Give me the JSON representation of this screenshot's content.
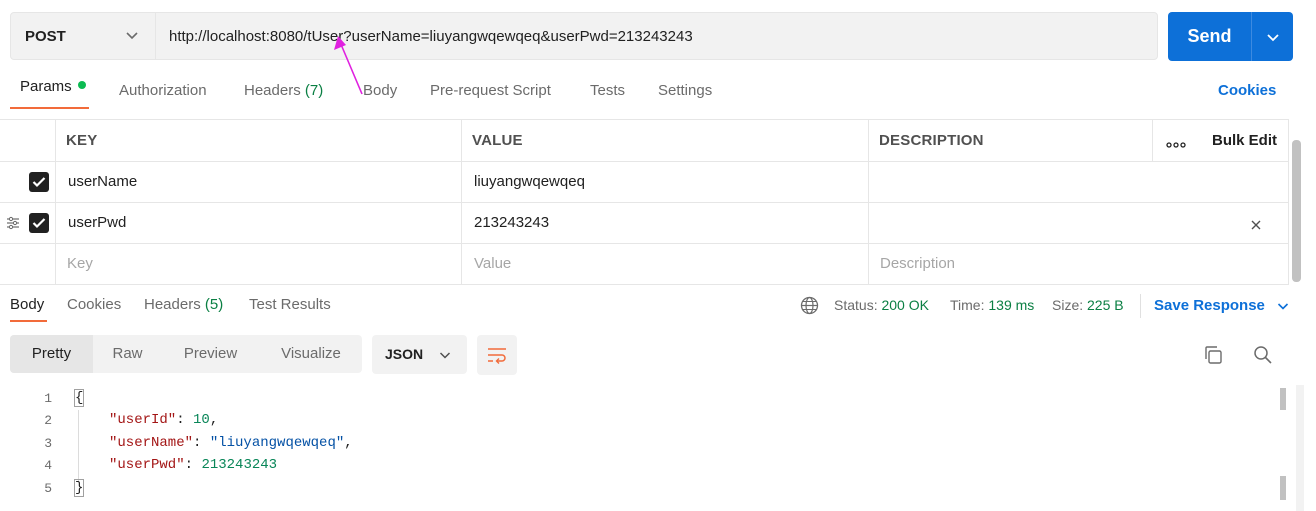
{
  "request": {
    "method": "POST",
    "url": "http://localhost:8080/tUser?userName=liuyangwqewqeq&userPwd=213243243",
    "send_label": "Send"
  },
  "request_tabs": {
    "params": "Params",
    "authorization": "Authorization",
    "headers": "Headers",
    "headers_count": "(7)",
    "body": "Body",
    "prerequest": "Pre-request Script",
    "tests": "Tests",
    "settings": "Settings",
    "cookies": "Cookies"
  },
  "params_table": {
    "columns": [
      "KEY",
      "VALUE",
      "DESCRIPTION"
    ],
    "more_label": "ooo",
    "bulk_edit": "Bulk Edit",
    "rows": [
      {
        "checked": true,
        "key": "userName",
        "value": "liuyangwqewqeq",
        "description": ""
      },
      {
        "checked": true,
        "key": "userPwd",
        "value": "213243243",
        "description": ""
      }
    ],
    "placeholders": {
      "key": "Key",
      "value": "Value",
      "description": "Description"
    }
  },
  "response_tabs": {
    "body": "Body",
    "cookies": "Cookies",
    "headers": "Headers",
    "headers_count": "(5)",
    "test_results": "Test Results"
  },
  "response_status": {
    "status_label": "Status:",
    "status_value": "200 OK",
    "time_label": "Time:",
    "time_value": "139 ms",
    "size_label": "Size:",
    "size_value": "225 B",
    "save_response": "Save Response"
  },
  "format_bar": {
    "modes": [
      "Pretty",
      "Raw",
      "Preview",
      "Visualize"
    ],
    "active_mode": "Pretty",
    "language": "JSON"
  },
  "response_body": {
    "line_numbers": [
      "1",
      "2",
      "3",
      "4",
      "5"
    ],
    "open_brace": "{",
    "close_brace": "}",
    "fields": [
      {
        "key": "\"userId\"",
        "value": "10",
        "type": "number",
        "trail": ","
      },
      {
        "key": "\"userName\"",
        "value": "\"liuyangwqewqeq\"",
        "type": "string",
        "trail": ","
      },
      {
        "key": "\"userPwd\"",
        "value": "213243243",
        "type": "number",
        "trail": ""
      }
    ]
  },
  "colors": {
    "accent_blue": "#0d70d8",
    "accent_orange": "#f26b3a",
    "success_green": "#0a7f43",
    "annotation_arrow": "#e020e0"
  }
}
